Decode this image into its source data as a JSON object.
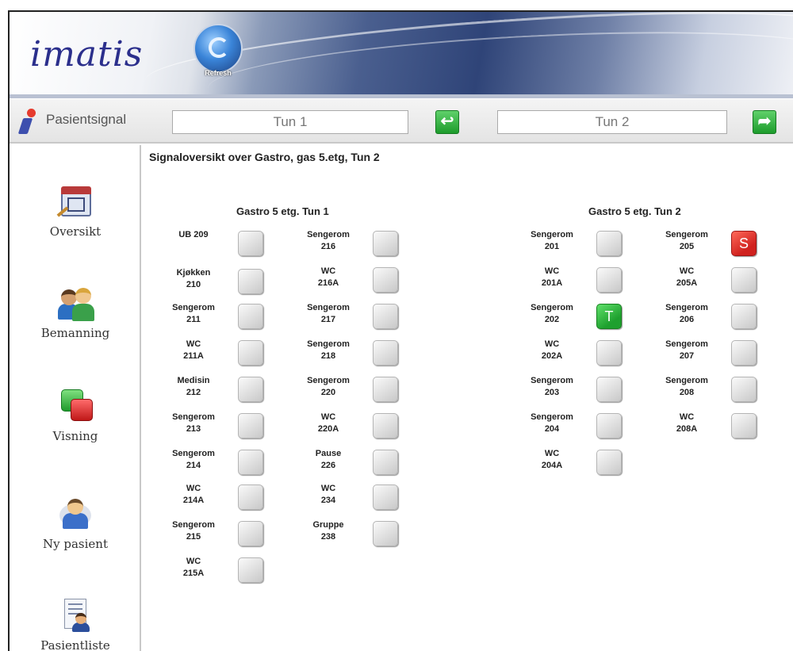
{
  "header": {
    "logo": "imatis",
    "refresh_label": "Refresh"
  },
  "toolbar": {
    "app_name": "Pasientsignal",
    "left_ward": "Tun 1",
    "right_ward": "Tun 2"
  },
  "sidebar": {
    "items": [
      {
        "label": "Oversikt",
        "icon": "calendar-icon"
      },
      {
        "label": "Bemanning",
        "icon": "people-icon"
      },
      {
        "label": "Visning",
        "icon": "display-toggle-icon"
      },
      {
        "label": "Ny pasient",
        "icon": "new-patient-icon"
      },
      {
        "label": "Pasientliste",
        "icon": "patient-list-icon"
      }
    ]
  },
  "main": {
    "title": "Signaloversikt over Gastro, gas 5.etg, Tun 2",
    "wards": [
      {
        "title": "Gastro 5 etg. Tun 1",
        "col1": [
          {
            "line1": "UB 209",
            "line2": "",
            "state": ""
          },
          {
            "line1": "Kjøkken",
            "line2": "210",
            "state": ""
          },
          {
            "line1": "Sengerom",
            "line2": "211",
            "state": ""
          },
          {
            "line1": "WC",
            "line2": "211A",
            "state": ""
          },
          {
            "line1": "Medisin",
            "line2": "212",
            "state": ""
          },
          {
            "line1": "Sengerom",
            "line2": "213",
            "state": ""
          },
          {
            "line1": "Sengerom",
            "line2": "214",
            "state": ""
          },
          {
            "line1": "WC",
            "line2": "214A",
            "state": ""
          },
          {
            "line1": "Sengerom",
            "line2": "215",
            "state": ""
          },
          {
            "line1": "WC",
            "line2": "215A",
            "state": ""
          }
        ],
        "col2": [
          {
            "line1": "Sengerom",
            "line2": "216",
            "state": ""
          },
          {
            "line1": "WC",
            "line2": "216A",
            "state": ""
          },
          {
            "line1": "Sengerom",
            "line2": "217",
            "state": ""
          },
          {
            "line1": "Sengerom",
            "line2": "218",
            "state": ""
          },
          {
            "line1": "Sengerom",
            "line2": "220",
            "state": ""
          },
          {
            "line1": "WC",
            "line2": "220A",
            "state": ""
          },
          {
            "line1": "Pause",
            "line2": "226",
            "state": ""
          },
          {
            "line1": "WC",
            "line2": "234",
            "state": ""
          },
          {
            "line1": "Gruppe",
            "line2": "238",
            "state": ""
          }
        ]
      },
      {
        "title": "Gastro 5 etg. Tun 2",
        "col1": [
          {
            "line1": "Sengerom",
            "line2": "201",
            "state": ""
          },
          {
            "line1": "WC",
            "line2": "201A",
            "state": ""
          },
          {
            "line1": "Sengerom",
            "line2": "202",
            "state": "T"
          },
          {
            "line1": "WC",
            "line2": "202A",
            "state": ""
          },
          {
            "line1": "Sengerom",
            "line2": "203",
            "state": ""
          },
          {
            "line1": "Sengerom",
            "line2": "204",
            "state": ""
          },
          {
            "line1": "WC",
            "line2": "204A",
            "state": ""
          }
        ],
        "col2": [
          {
            "line1": "Sengerom",
            "line2": "205",
            "state": "S"
          },
          {
            "line1": "WC",
            "line2": "205A",
            "state": ""
          },
          {
            "line1": "Sengerom",
            "line2": "206",
            "state": ""
          },
          {
            "line1": "Sengerom",
            "line2": "207",
            "state": ""
          },
          {
            "line1": "Sengerom",
            "line2": "208",
            "state": ""
          },
          {
            "line1": "WC",
            "line2": "208A",
            "state": ""
          }
        ]
      }
    ]
  },
  "colors": {
    "alarm_red": "#d0221f",
    "present_green": "#1ea02e",
    "idle_grey": "#dcdcdc"
  }
}
